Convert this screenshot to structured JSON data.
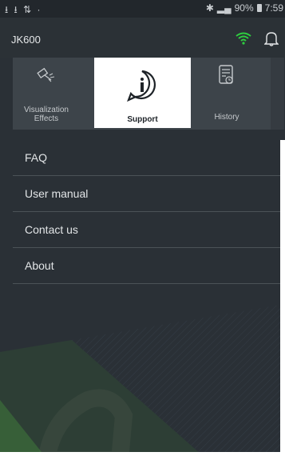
{
  "status_bar": {
    "left_icons": "⭳ ⭳ ⇅ ·",
    "battery": "90%",
    "time": "7:59"
  },
  "header": {
    "title": "JK600",
    "wifi_color": "#2ecc40"
  },
  "tabs": [
    {
      "label": "Visualization Effects",
      "icon": "satellite-icon"
    },
    {
      "label": "Support",
      "icon": "info-bubble-icon",
      "selected": true
    },
    {
      "label": "History",
      "icon": "document-history-icon"
    }
  ],
  "menu": {
    "items": [
      {
        "label": "FAQ"
      },
      {
        "label": "User manual"
      },
      {
        "label": "Contact us"
      },
      {
        "label": "About"
      }
    ]
  },
  "colors": {
    "background": "#2a3036",
    "accent_green": "#2ecc40",
    "selected_tab_bg": "#ffffff"
  }
}
